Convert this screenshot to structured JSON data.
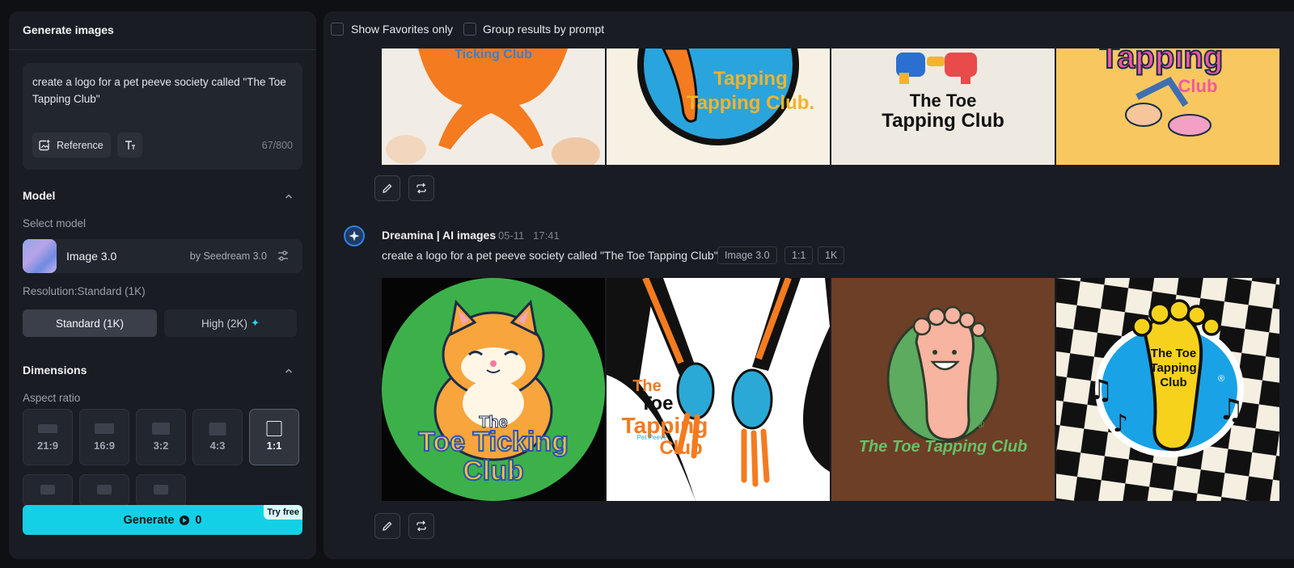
{
  "left_panel": {
    "title": "Generate images",
    "prompt": {
      "text": "create a logo for a pet peeve society called \"The Toe Tapping Club\"",
      "reference_label": "Reference",
      "counter": "67/800"
    },
    "model_section": {
      "title": "Model",
      "select_label": "Select model",
      "model_name": "Image 3.0",
      "model_by": "by Seedream 3.0",
      "resolution_label": "Resolution:Standard (1K)",
      "resolution_options": [
        "Standard (1K)",
        "High (2K)"
      ],
      "selected_resolution": "Standard (1K)"
    },
    "dimensions_section": {
      "title": "Dimensions",
      "aspect_label": "Aspect ratio",
      "ratios": [
        "21:9",
        "16:9",
        "3:2",
        "4:3",
        "1:1"
      ],
      "selected_ratio": "1:1"
    },
    "generate": {
      "label": "Generate",
      "credits": "0",
      "badge": "Try free"
    }
  },
  "right_panel": {
    "filters": {
      "favorites_label": "Show Favorites only",
      "group_label": "Group results by prompt"
    },
    "top_batch": {
      "images": [
        {
          "text": "Ticking Club"
        },
        {
          "text": "Tapping Club."
        },
        {
          "text": "The Toe Tapping Club"
        },
        {
          "text": "Tapping Club"
        }
      ]
    },
    "latest_batch": {
      "app_name": "Dreamina | AI images",
      "date": "05-11",
      "time": "17:41",
      "prompt": "create a logo for a pet peeve society called \"The Toe Tapping Club\"",
      "tags": [
        "Image 3.0",
        "1:1",
        "1K"
      ],
      "images": [
        {
          "line1": "The",
          "line2": "Toe Ticking",
          "line3": "Club"
        },
        {
          "line1": "The",
          "line2": "Toe",
          "line3": "Tapping",
          "line4": "Club",
          "line5": "Pet Peeve"
        },
        {
          "text": "The Toe Tapping Club"
        },
        {
          "line1": "The Toe",
          "line2": "Tapping",
          "line3": "Club"
        }
      ]
    }
  },
  "colors": {
    "accent": "#14d0e6",
    "background": "#0e1014",
    "panel": "#191c22"
  }
}
